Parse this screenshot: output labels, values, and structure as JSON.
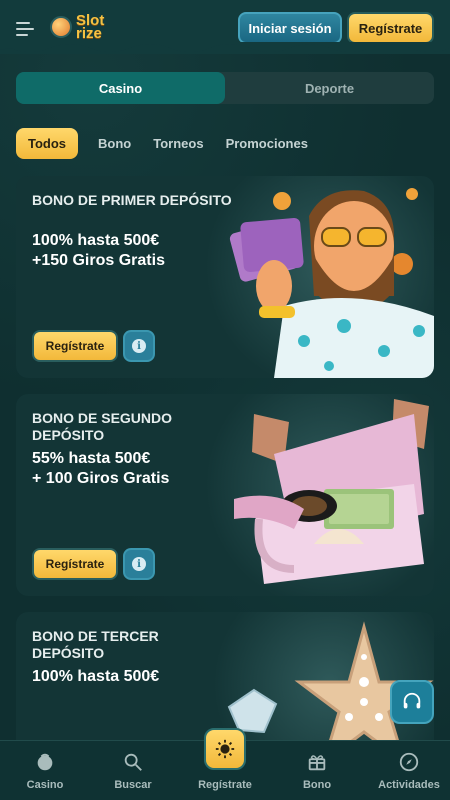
{
  "header": {
    "logo_text_1": "Slot",
    "logo_text_2": "rize",
    "login_label": "Iniciar sesión",
    "register_label": "Regístrate"
  },
  "segment": {
    "tabs": [
      {
        "label": "Casino",
        "active": true
      },
      {
        "label": "Deporte",
        "active": false
      }
    ]
  },
  "filters": [
    {
      "label": "Todos",
      "active": true
    },
    {
      "label": "Bono",
      "active": false
    },
    {
      "label": "Torneos",
      "active": false
    },
    {
      "label": "Promociones",
      "active": false
    }
  ],
  "cards": [
    {
      "title": "BONO DE PRIMER DEPÓSITO",
      "amount_line_1": "100% hasta 500€",
      "amount_line_2": "+150 Giros Gratis",
      "button_label": "Regístrate",
      "info_symbol": "i"
    },
    {
      "title": "BONO DE SEGUNDO DEPÓSITO",
      "amount_line_1": "55% hasta 500€",
      "amount_line_2": "+ 100 Giros Gratis",
      "button_label": "Regístrate",
      "info_symbol": "i"
    },
    {
      "title": "BONO DE TERCER DEPÓSITO",
      "amount_line_1": "100% hasta 500€"
    }
  ],
  "bottom_nav": [
    {
      "label": "Casino",
      "icon": "casino-icon"
    },
    {
      "label": "Buscar",
      "icon": "search-icon"
    },
    {
      "label": "Regístrate",
      "icon": "sun-icon"
    },
    {
      "label": "Bono",
      "icon": "gift-icon"
    },
    {
      "label": "Actividades",
      "icon": "compass-icon"
    }
  ],
  "colors": {
    "accent_yellow": "#f2b83a",
    "accent_teal": "#0f6b68",
    "accent_blue": "#1a6782",
    "background": "#0f2f30"
  }
}
